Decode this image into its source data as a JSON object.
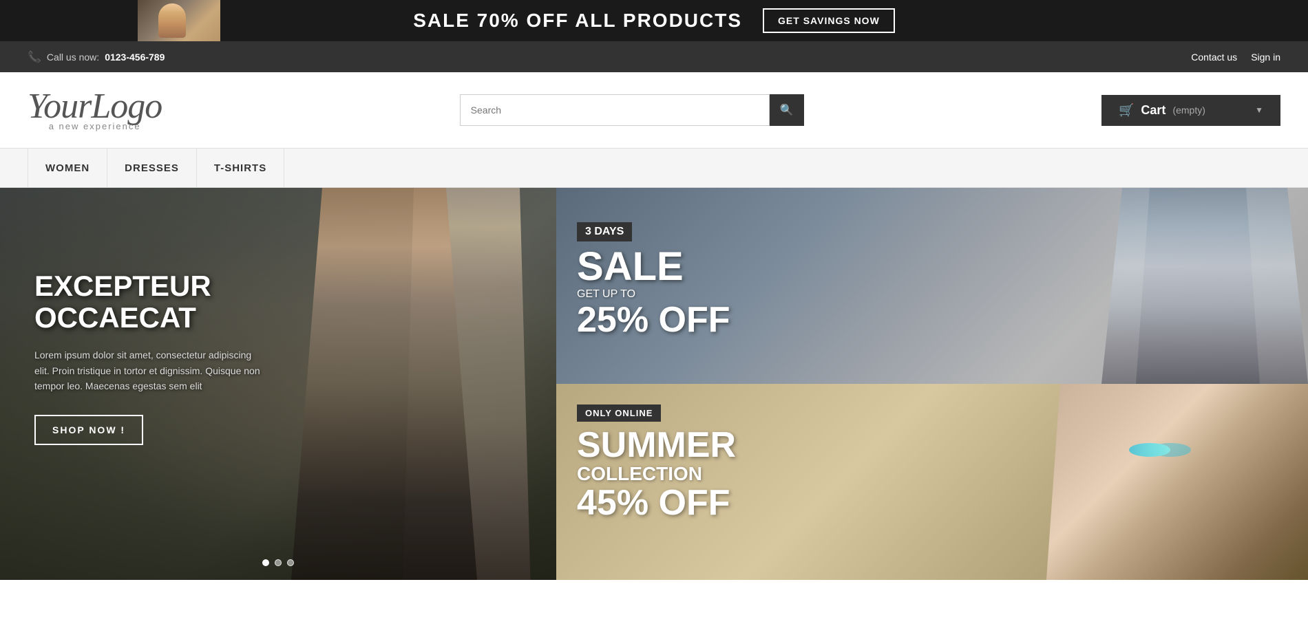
{
  "topBanner": {
    "saleText": "SALE 70% OFF ALL PRODUCTS",
    "btnLabel": "GET SAVINGS NOW"
  },
  "secondaryBar": {
    "callLabel": "Call us now:",
    "phone": "0123-456-789",
    "contactLabel": "Contact us",
    "signInLabel": "Sign in"
  },
  "header": {
    "logoText": "YourLogo",
    "logoSub": "a new experience",
    "searchPlaceholder": "Search",
    "searchIcon": "🔍",
    "cartLabel": "Cart",
    "cartStatus": "(empty)",
    "cartIcon": "🛒"
  },
  "nav": {
    "items": [
      {
        "label": "WOMEN"
      },
      {
        "label": "DRESSES"
      },
      {
        "label": "T-SHIRTS"
      }
    ]
  },
  "hero": {
    "title": "EXCEPTEUR\nOCCAECAT",
    "description": "Lorem ipsum dolor sit amet, consectetur adipiscing elit. Proin tristique in tortor et dignissim. Quisque non tempor leo. Maecenas egestas sem elit",
    "shopNowLabel": "SHOP NOW !"
  },
  "sideBannerTop": {
    "daysBadge": "3 DAYS",
    "saleLabel": "SALE",
    "getUpLabel": "GET UP TO",
    "percentOff": "25% OFF"
  },
  "sideBannerBottom": {
    "onlineBadge": "ONLY ONLINE",
    "summerTitle": "SUMMER",
    "collectionLabel": "COLLECTION",
    "percentOff": "45% OFF"
  },
  "pagination": {
    "dots": [
      {
        "active": true
      },
      {
        "active": false
      },
      {
        "active": false
      }
    ]
  }
}
